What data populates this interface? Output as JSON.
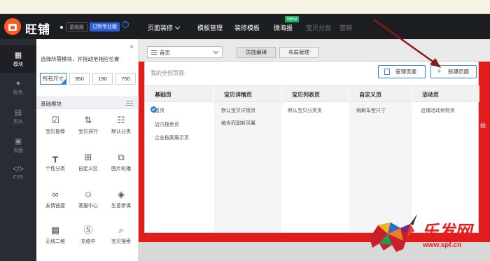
{
  "app": {
    "brand": "旺铺",
    "edition_basic": "基础版",
    "edition_pro": "订购专业版"
  },
  "topnav": {
    "items": [
      {
        "label": "页面装修",
        "has_caret": true
      },
      {
        "label": "模板管理"
      },
      {
        "label": "装修模板"
      },
      {
        "label": "微海报",
        "badge": "New"
      },
      {
        "label": "宝贝分类",
        "dim": true
      },
      {
        "label": "营销",
        "dim": true
      }
    ]
  },
  "leftbar": {
    "items": [
      {
        "label": "模块",
        "icon": "grid-icon",
        "active": true
      },
      {
        "label": "配色",
        "icon": "palette-icon"
      },
      {
        "label": "页头",
        "icon": "header-icon"
      },
      {
        "label": "页面",
        "icon": "page-icon"
      },
      {
        "label": "CSS",
        "icon": "code-icon"
      }
    ]
  },
  "panel": {
    "close": "×",
    "hint": "选择所需模块，并拖动至相应位置",
    "help": "?",
    "sizes": [
      "所有尺寸",
      "950",
      "190",
      "750"
    ],
    "section_title": "基础模块",
    "modules": [
      {
        "label": "宝贝推荐",
        "icon": "recommend-icon",
        "glyph": "☑"
      },
      {
        "label": "宝贝排行",
        "icon": "rank-icon",
        "glyph": "⇅"
      },
      {
        "label": "默认分类",
        "icon": "category-icon",
        "glyph": "☷"
      },
      {
        "label": "个性分类",
        "icon": "custom-category-icon",
        "glyph": "┳"
      },
      {
        "label": "自定义区",
        "icon": "custom-area-icon",
        "glyph": "⊞"
      },
      {
        "label": "图片轮播",
        "icon": "carousel-icon",
        "glyph": "⧉"
      },
      {
        "label": "友情链接",
        "icon": "link-icon",
        "glyph": "∞"
      },
      {
        "label": "客服中心",
        "icon": "service-icon",
        "glyph": "☺"
      },
      {
        "label": "生意参谋",
        "icon": "compass-icon",
        "glyph": "◈"
      },
      {
        "label": "无线二维",
        "icon": "qrcode-icon",
        "glyph": "▦"
      },
      {
        "label": "充值中",
        "icon": "recharge-icon",
        "glyph": "Ⓢ"
      },
      {
        "label": "宝贝搜索",
        "icon": "search-icon",
        "glyph": "⌕"
      }
    ]
  },
  "canvas": {
    "page_select": "首页",
    "tabs": [
      "页面编辑",
      "布局管理"
    ],
    "band_text": "始"
  },
  "popup": {
    "title": "我的全部页面:",
    "manage_button": "管理页面",
    "new_button": "新建页面",
    "columns": [
      {
        "header": "基础页",
        "links": [
          "首页",
          "店内搜索页",
          "企业档案展示页"
        ]
      },
      {
        "header": "宝贝详情页",
        "links": [
          "默认宝贝详情页",
          "编世而副新风翼"
        ]
      },
      {
        "header": "宝贝列表页",
        "links": [
          "默认宝贝分类页"
        ]
      },
      {
        "header": "自定义页",
        "links": [
          "雨刷车型尺寸"
        ]
      },
      {
        "header": "活动页",
        "links": [
          "店铺活动优购页"
        ]
      }
    ]
  },
  "watermark": {
    "logo_text": "乐发网",
    "url": "www.spf.cn"
  },
  "colors": {
    "topbar": "#1d1e22",
    "accent_blue": "#2f7fe6",
    "brand_orange": "#ff5a1f",
    "band_red": "#e11c1c",
    "arrow": "#8b1a1a"
  }
}
